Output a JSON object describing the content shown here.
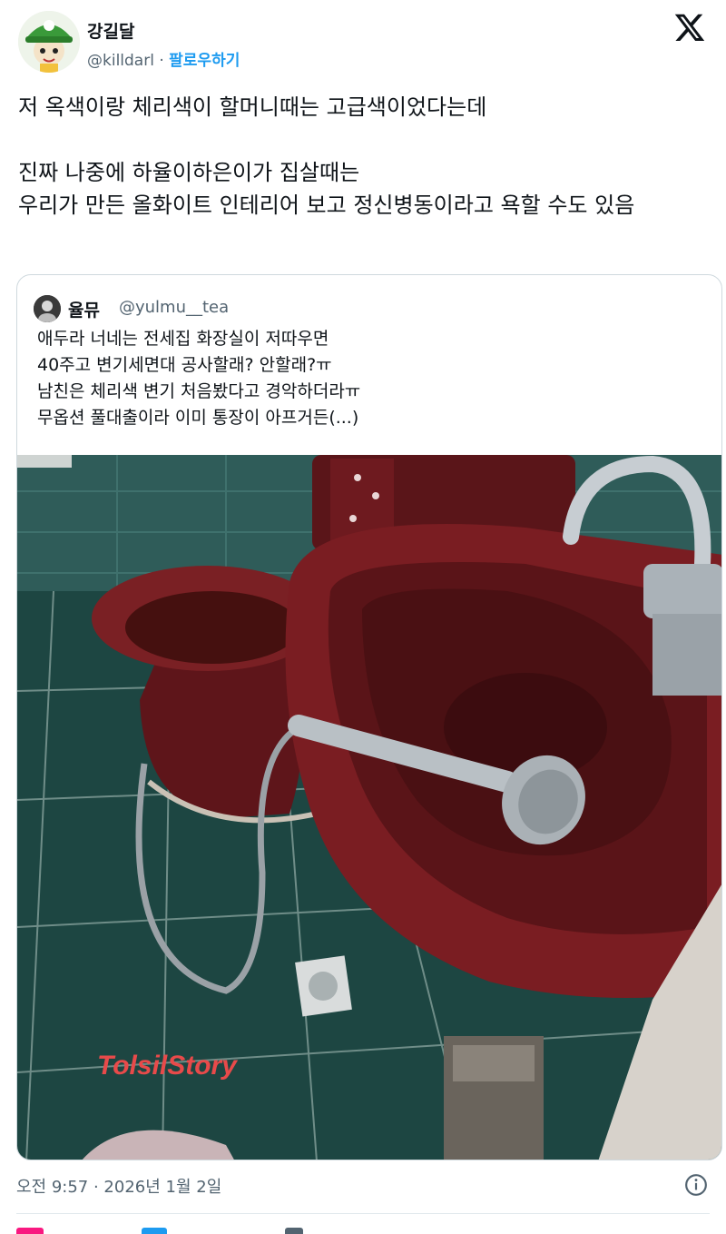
{
  "author": {
    "display_name": "강길달",
    "handle": "@killdarl",
    "separator": "·",
    "follow_label": "팔로우하기",
    "avatar_icon": "green-cap-character-avatar"
  },
  "platform_icon": "x-logo-icon",
  "tweet": {
    "text": "저 옥색이랑 체리색이 할머니때는 고급색이었다는데\n\n진짜 나중에 하율이하은이가 집살때는\n우리가 만든 올화이트 인테리어 보고 정신병동이라고 욕할 수도 있음"
  },
  "quote": {
    "display_name": "율뮤",
    "handle": "@yulmu__tea",
    "text": "애두라 너네는 전세집 화장실이 저따우면\n40주고 변기세면대 공사할래? 안할래?ㅠ\n남친은 체리색 변기 처음봤다고 경악하더라ㅠ\n무옵션 풀대출이라 이미 통장이 아프거든(...)",
    "media": {
      "description_icon": "bathroom-photo",
      "watermark": "TolsilStory"
    }
  },
  "timestamp": "오전 9:57 · 2026년 1월 2일",
  "colors": {
    "follow": "#1d9bf0",
    "secondary_text": "#536471",
    "border": "#cfd9de",
    "cherry": "#6e1a1f",
    "tile": "#1f4a45"
  }
}
